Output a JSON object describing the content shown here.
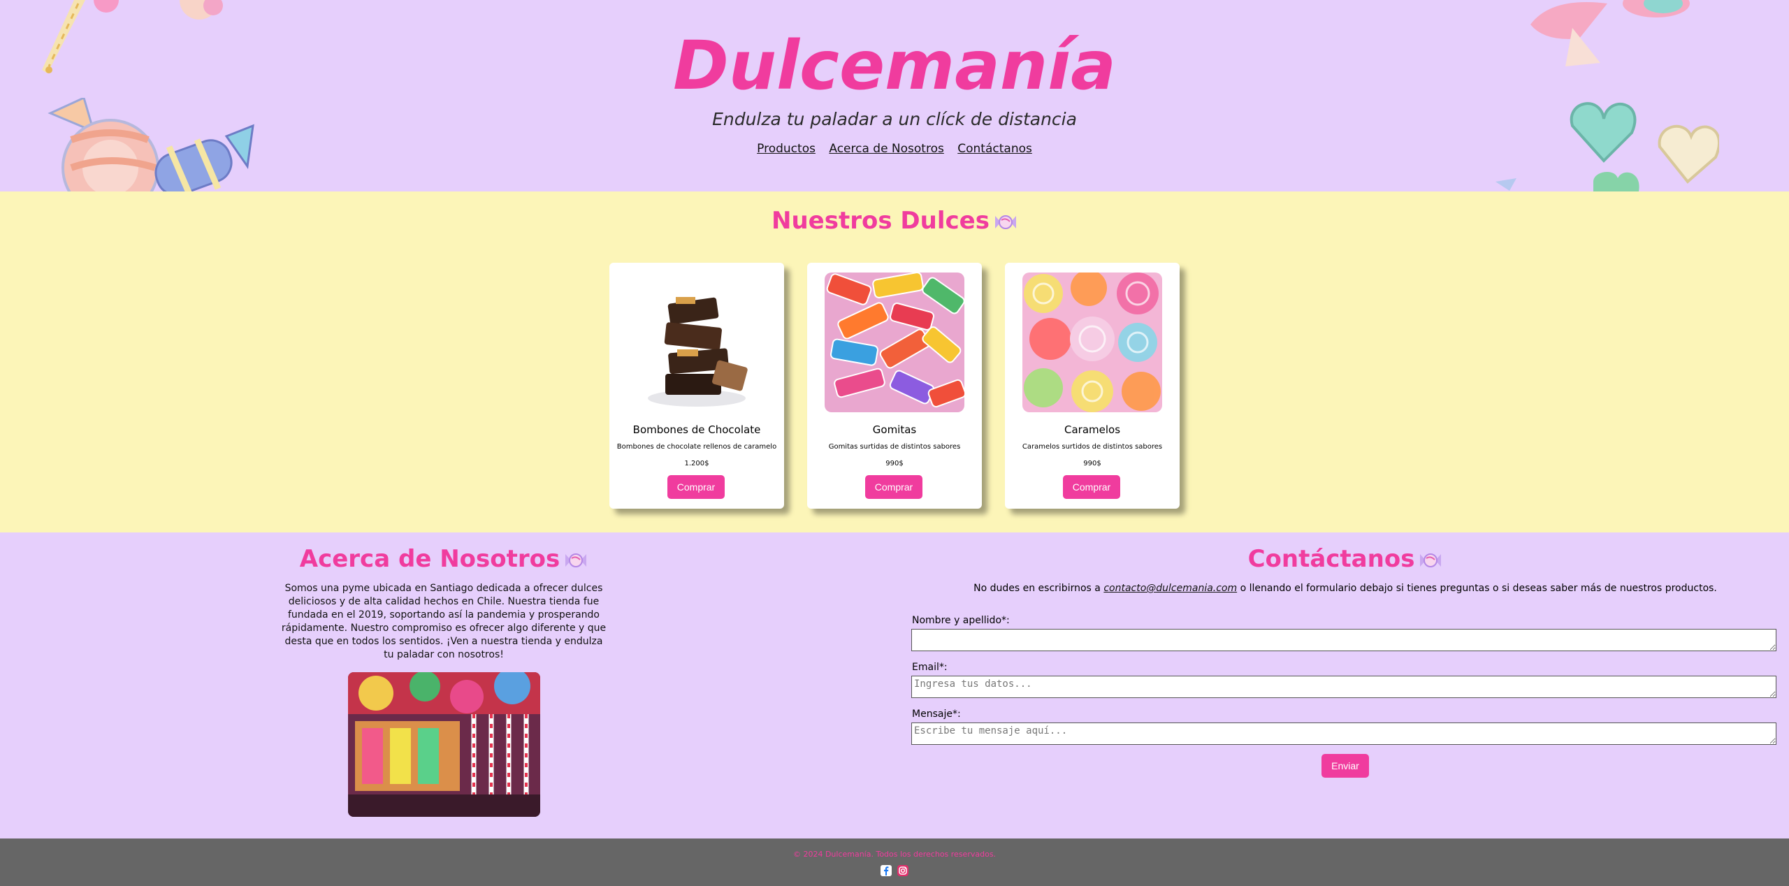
{
  "header": {
    "brand": "Dulcemanía",
    "tagline": "Endulza tu paladar a un clíck de distancia",
    "nav": [
      "Productos",
      "Acerca de Nosotros",
      "Contáctanos"
    ]
  },
  "products": {
    "title": "Nuestros Dulces",
    "title_icon": "candy-icon",
    "items": [
      {
        "name": "Bombones de Chocolate",
        "description": "Bombones de chocolate rellenos de caramelo",
        "price": "1.200$",
        "button": "Comprar",
        "image": "chocolate-bonbons-image"
      },
      {
        "name": "Gomitas",
        "description": "Gomitas surtidas de distintos sabores",
        "price": "990$",
        "button": "Comprar",
        "image": "gummies-image"
      },
      {
        "name": "Caramelos",
        "description": "Caramelos surtidos de distintos sabores",
        "price": "990$",
        "button": "Comprar",
        "image": "wrapped-candies-image"
      }
    ]
  },
  "about": {
    "title": "Acerca de Nosotros",
    "text": "Somos una pyme ubicada en Santiago dedicada a ofrecer dulces deliciosos y de alta calidad hechos en Chile. Nuestra tienda fue fundada en el 2019, soportando así la pandemia y prosperando rápidamente. Nuestro compromiso es ofrecer algo diferente y que desta que en todos los sentidos. ¡Ven a nuestra tienda y endulza tu paladar con nosotros!",
    "image": "candy-store-image"
  },
  "contact": {
    "title": "Contáctanos",
    "intro_before": "No dudes en escribirnos a ",
    "email": "contacto@dulcemania.com",
    "intro_after": " o llenando el formulario debajo si tienes preguntas o si deseas saber más de nuestros productos.",
    "fields": [
      {
        "label": "Nombre y apellido*:",
        "placeholder": ""
      },
      {
        "label": "Email*:",
        "placeholder": "Ingresa tus datos..."
      },
      {
        "label": "Mensaje*:",
        "placeholder": "Escribe tu mensaje aquí..."
      }
    ],
    "submit": "Enviar"
  },
  "footer": {
    "copyright": "© 2024 Dulcemanía. Todos los derechos reservados.",
    "social": [
      "facebook-icon",
      "instagram-icon"
    ]
  },
  "colors": {
    "accent": "#f03c9e",
    "lavender": "#e6cffc",
    "cream": "#fcf5b8",
    "footer": "#666666"
  }
}
